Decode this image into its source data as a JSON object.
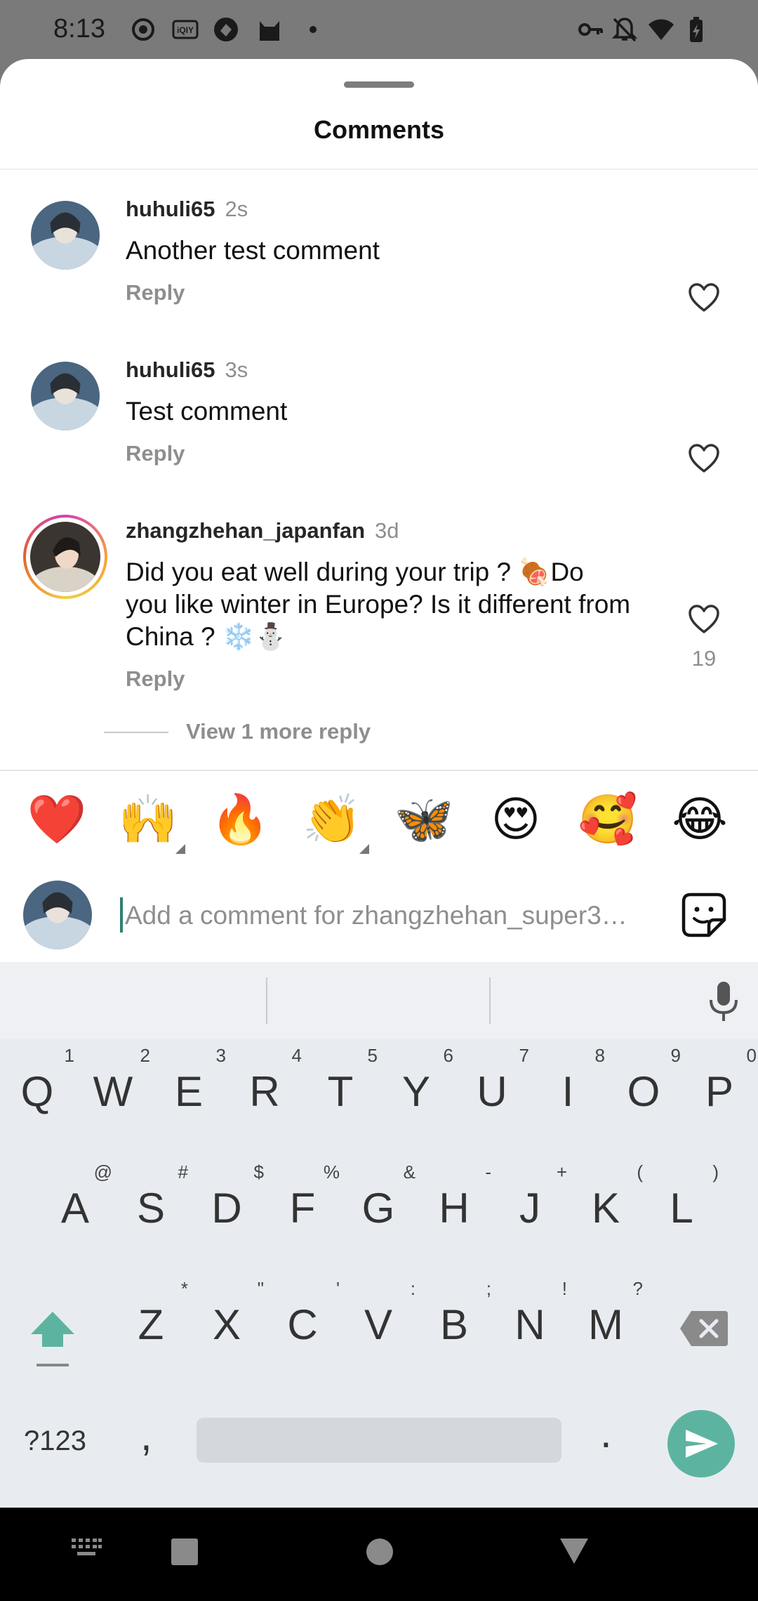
{
  "status_bar": {
    "time": "8:13",
    "left_icons": [
      "record-icon",
      "iqiyi-icon",
      "app-icon",
      "cat-icon",
      "dot-icon"
    ],
    "right_icons": [
      "vpn-key-icon",
      "notifications-off-icon",
      "wifi-icon",
      "battery-charging-icon"
    ]
  },
  "sheet": {
    "title": "Comments"
  },
  "comments": [
    {
      "username": "huhuli65",
      "time": "2s",
      "text": "Another test comment",
      "reply_label": "Reply",
      "likes": ""
    },
    {
      "username": "huhuli65",
      "time": "3s",
      "text": "Test comment",
      "reply_label": "Reply",
      "likes": ""
    },
    {
      "username": "zhangzhehan_japanfan",
      "time": "3d",
      "text": "Did you eat well during your trip ? 🍖Do you like winter in Europe? Is it different from China ? ❄️⛄",
      "reply_label": "Reply",
      "likes": "19"
    }
  ],
  "view_more_replies": "View 1 more reply",
  "quick_emojis": [
    "❤️",
    "🙌",
    "🔥",
    "👏",
    "🦋",
    "😍",
    "🥰",
    "😂"
  ],
  "composer": {
    "placeholder": "Add a comment for zhangzhehan_super3…",
    "value": ""
  },
  "keyboard": {
    "row1": [
      {
        "key": "Q",
        "alt": "1"
      },
      {
        "key": "W",
        "alt": "2"
      },
      {
        "key": "E",
        "alt": "3"
      },
      {
        "key": "R",
        "alt": "4"
      },
      {
        "key": "T",
        "alt": "5"
      },
      {
        "key": "Y",
        "alt": "6"
      },
      {
        "key": "U",
        "alt": "7"
      },
      {
        "key": "I",
        "alt": "8"
      },
      {
        "key": "O",
        "alt": "9"
      },
      {
        "key": "P",
        "alt": "0"
      }
    ],
    "row2": [
      {
        "key": "A",
        "alt": "@"
      },
      {
        "key": "S",
        "alt": "#"
      },
      {
        "key": "D",
        "alt": "$"
      },
      {
        "key": "F",
        "alt": "%"
      },
      {
        "key": "G",
        "alt": "&"
      },
      {
        "key": "H",
        "alt": "-"
      },
      {
        "key": "J",
        "alt": "+"
      },
      {
        "key": "K",
        "alt": "("
      },
      {
        "key": "L",
        "alt": ")"
      }
    ],
    "row3": [
      {
        "key": "Z",
        "alt": "*"
      },
      {
        "key": "X",
        "alt": "\""
      },
      {
        "key": "C",
        "alt": "'"
      },
      {
        "key": "V",
        "alt": ":"
      },
      {
        "key": "B",
        "alt": ";"
      },
      {
        "key": "N",
        "alt": "!"
      },
      {
        "key": "M",
        "alt": "?"
      }
    ],
    "symbols_label": "?123",
    "comma": ",",
    "period": "."
  },
  "colors": {
    "accent_send": "#5cb4a0",
    "muted_text": "#8e8e8e",
    "keyboard_bg": "#e8ecf0"
  }
}
